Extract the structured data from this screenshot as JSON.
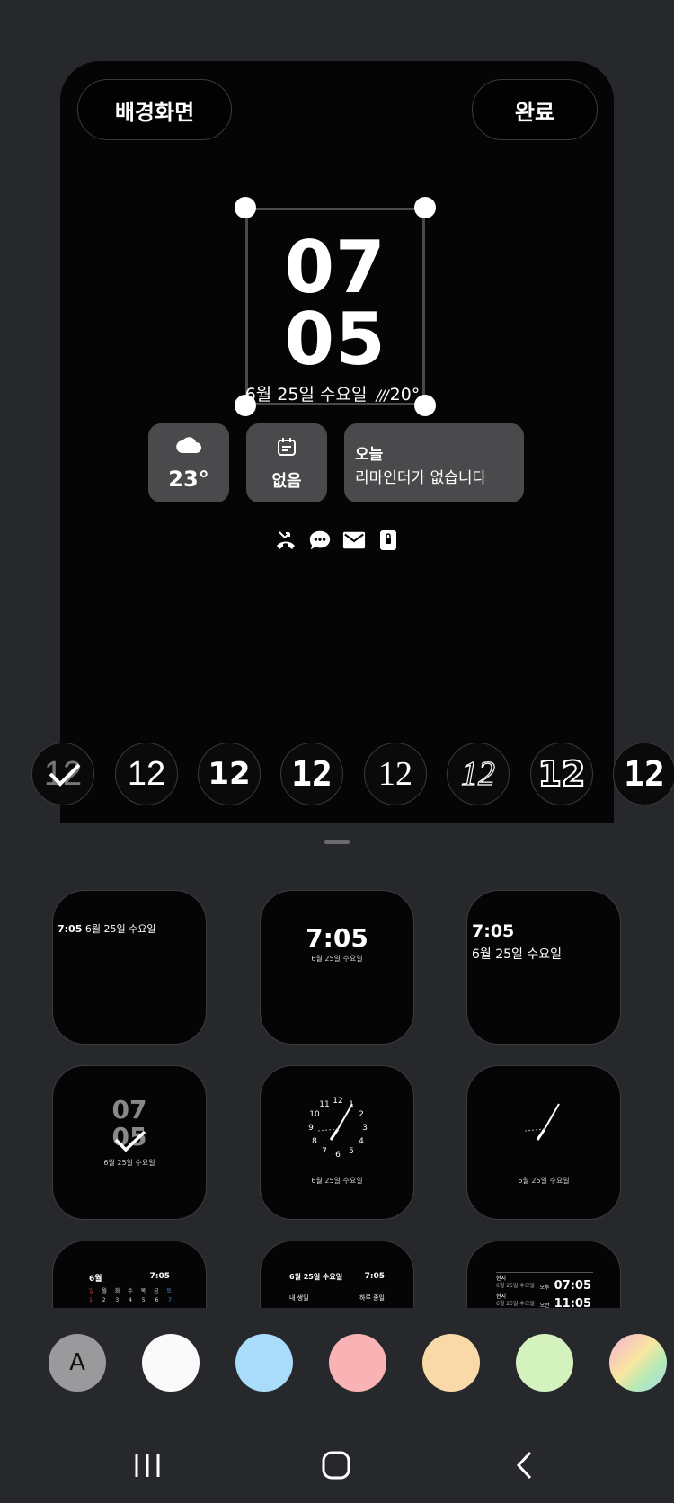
{
  "header": {
    "wallpaper_label": "배경화면",
    "done_label": "완료"
  },
  "clock": {
    "hour": "07",
    "minute": "05",
    "date": "6월 25일 수요일",
    "temp": "20°"
  },
  "widgets": {
    "weather_temp": "23°",
    "calendar_text": "없음",
    "reminder_title": "오늘",
    "reminder_text": "리마인더가 없습니다"
  },
  "notification_icons": [
    "missed-call-icon",
    "message-icon",
    "email-icon",
    "lock-icon"
  ],
  "font_styles": {
    "sample": "12",
    "selected_index": 0,
    "count": 8
  },
  "clock_styles": {
    "s1_time": "7:05",
    "s1_date": "6월 25일 수요일",
    "s2_time": "7:05",
    "s2_date": "6월 25일 수요일",
    "s3_time": "7:05",
    "s3_date": "6월 25일 수요일",
    "s4_hour": "07",
    "s4_min": "05",
    "s4_date": "6월 25일 수요일",
    "s5_date": "6월 25일 수요일",
    "s5_numbers": [
      "12",
      "1",
      "2",
      "3",
      "4",
      "5",
      "6",
      "7",
      "8",
      "9",
      "10",
      "11"
    ],
    "s6_date": "6월 25일 수요일",
    "s7_month": "6월",
    "s7_time": "7:05",
    "s7_weekdays": [
      "일",
      "월",
      "화",
      "수",
      "목",
      "금",
      "토"
    ],
    "s7_days": [
      "1",
      "2",
      "3",
      "4",
      "5",
      "6",
      "7"
    ],
    "s8_date": "6월 25일 수요일",
    "s8_time": "7:05",
    "s8_event1": "내 생일",
    "s8_event2": "하루 종일",
    "s9_label1": "현지",
    "s9_date1": "6월 25일 수요일",
    "s9_ampm1": "오후",
    "s9_time1": "07:05",
    "s9_label2": "현지",
    "s9_date2": "6월 25일 수요일",
    "s9_ampm2": "오전",
    "s9_time2": "11:05",
    "selected_index": 3
  },
  "colors": {
    "auto_label": "A",
    "swatches": [
      "#9a9a9c",
      "#fafafa",
      "#a8dcfa",
      "#f9b3b4",
      "#fad9a8",
      "#d4f2be"
    ]
  }
}
